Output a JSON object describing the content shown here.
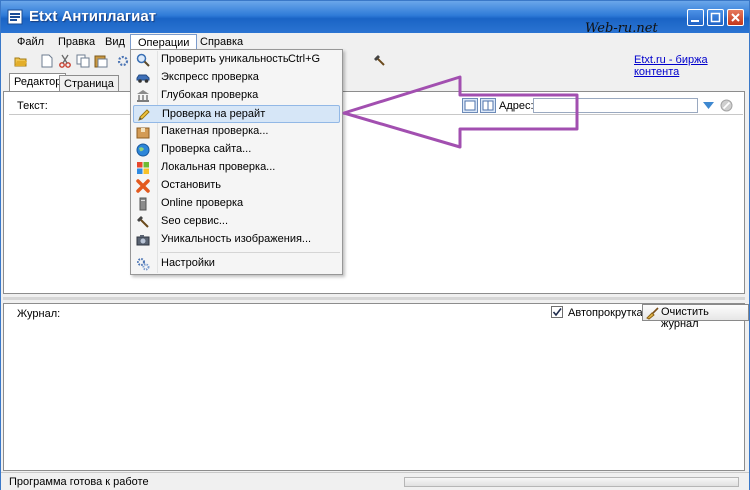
{
  "window": {
    "title": "Etxt Антиплагиат",
    "watermark": "Web-ru.net"
  },
  "menubar": {
    "items": [
      "Файл",
      "Правка",
      "Вид",
      "Операции",
      "Справка"
    ],
    "active": "Операции"
  },
  "toolbar": {
    "etxt_link": "Etxt.ru - биржа контента"
  },
  "tabs": [
    "Редактор",
    "Страница"
  ],
  "editor": {
    "text_label": "Текст:",
    "address_label": "Адрес:",
    "address_value": ""
  },
  "dropdown": {
    "items": [
      {
        "label": "Проверить уникальность",
        "shortcut": "Ctrl+G",
        "icon": "magnifier-icon"
      },
      {
        "label": "Экспресс проверка",
        "shortcut": "",
        "icon": "car-icon"
      },
      {
        "label": "Глубокая проверка",
        "shortcut": "",
        "icon": "bank-icon"
      },
      {
        "label": "Проверка на рерайт",
        "shortcut": "",
        "icon": "pencil-icon"
      },
      {
        "label": "Пакетная проверка...",
        "shortcut": "",
        "icon": "package-icon"
      },
      {
        "label": "Проверка сайта...",
        "shortcut": "",
        "icon": "globe-icon"
      },
      {
        "label": "Локальная проверка...",
        "shortcut": "",
        "icon": "windows-icon"
      },
      {
        "label": "Остановить",
        "shortcut": "",
        "icon": "stop-icon"
      },
      {
        "label": "Online проверка",
        "shortcut": "",
        "icon": "computer-icon"
      },
      {
        "label": "Seo сервис...",
        "shortcut": "",
        "icon": "hammer-icon"
      },
      {
        "label": "Уникальность изображения...",
        "shortcut": "",
        "icon": "camera-icon"
      },
      {
        "label": "Настройки",
        "shortcut": "",
        "icon": "gears-icon"
      }
    ],
    "highlighted": "Проверка на рерайт"
  },
  "journal": {
    "label": "Журнал:",
    "autoscroll_label": "Автопрокрутка",
    "autoscroll_checked": true,
    "clear_button": "Очистить журнал"
  },
  "status": {
    "text": "Программа готова к работе"
  },
  "colors": {
    "titlebar": "#2f7bd8",
    "annotation_arrow": "#a24fb0",
    "link": "#0000cc"
  }
}
